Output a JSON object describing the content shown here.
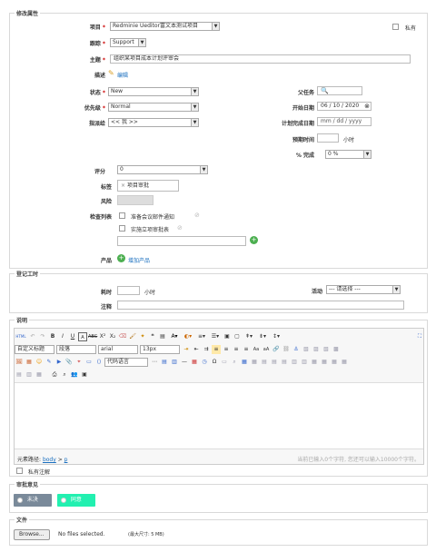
{
  "section_edit": {
    "legend": "修改属性",
    "project": {
      "label": "项目",
      "value": "Redminie Ueditor富文本测试项目"
    },
    "private": {
      "label": "私有"
    },
    "tracker": {
      "label": "跟踪",
      "value": "Support"
    },
    "subject": {
      "label": "主题",
      "value": "组织某项目成本计划评审会"
    },
    "description": {
      "label": "描述",
      "link": "编辑"
    },
    "status": {
      "label": "状态",
      "value": "New"
    },
    "parent_task": {
      "label": "父任务"
    },
    "priority": {
      "label": "优先级",
      "value": "Normal"
    },
    "start_date": {
      "label": "开始日期",
      "value": "06 / 10 / 2020"
    },
    "assignee": {
      "label": "指派给",
      "value": "<< 我 >>"
    },
    "due_date": {
      "label": "计划完成日期",
      "value": "mm / dd / yyyy"
    },
    "estimated_time": {
      "label": "预期时间",
      "unit": "小时"
    },
    "done_ratio": {
      "label": "% 完成",
      "value": "0 %"
    },
    "rating": {
      "label": "评分",
      "value": "0"
    },
    "tags": {
      "label": "标签",
      "tag": "项目审批"
    },
    "risk": {
      "label": "风险"
    },
    "checklist": {
      "label": "检查列表",
      "items": [
        "准备会议邮件通知",
        "实施立项审批表"
      ]
    },
    "product": {
      "label": "产品",
      "link": "增加产品"
    }
  },
  "section_time": {
    "legend": "登记工时",
    "hours": {
      "label": "耗时",
      "unit": "小时"
    },
    "activity": {
      "label": "活动",
      "value": "--- 请选择 ---"
    },
    "comment": {
      "label": "注释"
    }
  },
  "section_notes": {
    "legend": "说明",
    "toolbar": {
      "html_label": "HTML",
      "heading_select": "自定义标题",
      "paragraph_select": "段落",
      "font_select": "arial",
      "size_select": "13px",
      "code_select": "代码语言"
    },
    "path_label": "元素路径:",
    "path_body": "body",
    "path_sep": " > ",
    "path_p": "p",
    "word_count": "当前已输入0个字符, 您还可以输入10000个字符。",
    "private_notes": "私有注解"
  },
  "section_approval": {
    "legend": "审批意见",
    "reject": "未决",
    "approve": "同意",
    "colors": {
      "reject": "#7a8a9a",
      "approve": "#22f0b0"
    }
  },
  "section_file": {
    "legend": "文件",
    "browse": "Browse...",
    "no_files": "No files selected.",
    "max_size": "(最大尺寸: 5 MB)"
  }
}
